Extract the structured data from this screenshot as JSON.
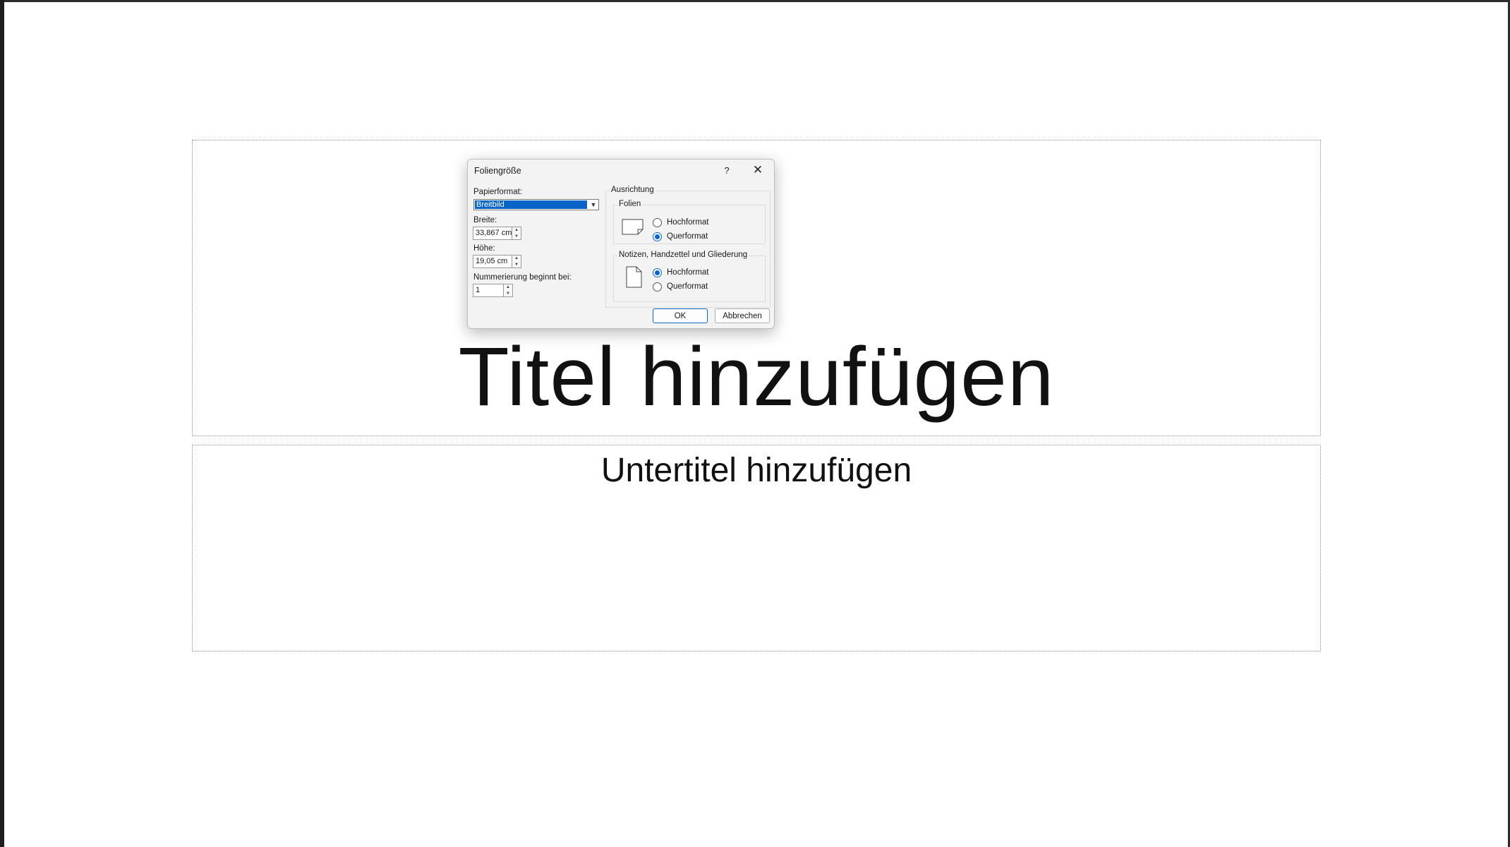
{
  "slide": {
    "title_placeholder": "Titel hinzufügen",
    "subtitle_placeholder": "Untertitel hinzufügen"
  },
  "dialog": {
    "title": "Foliengröße",
    "help_label": "?",
    "close_label": "✕",
    "paper_format_label": "Papierformat:",
    "paper_format_value": "Breitbild",
    "width_label": "Breite:",
    "width_value": "33,867 cm",
    "height_label": "Höhe:",
    "height_value": "19,05 cm",
    "numbering_label": "Nummerierung beginnt bei:",
    "numbering_value": "1",
    "orientation_label": "Ausrichtung",
    "slides_group": {
      "label": "Folien",
      "options": [
        {
          "label": "Hochformat",
          "checked": false
        },
        {
          "label": "Querformat",
          "checked": true
        }
      ]
    },
    "notes_group": {
      "label": "Notizen, Handzettel und Gliederung",
      "options": [
        {
          "label": "Hochformat",
          "checked": true
        },
        {
          "label": "Querformat",
          "checked": false
        }
      ]
    },
    "ok_label": "OK",
    "cancel_label": "Abbrechen"
  },
  "colors": {
    "accent": "#0a64c8",
    "dialog_bg": "#f3f3f3",
    "slide_text": "#111111"
  }
}
